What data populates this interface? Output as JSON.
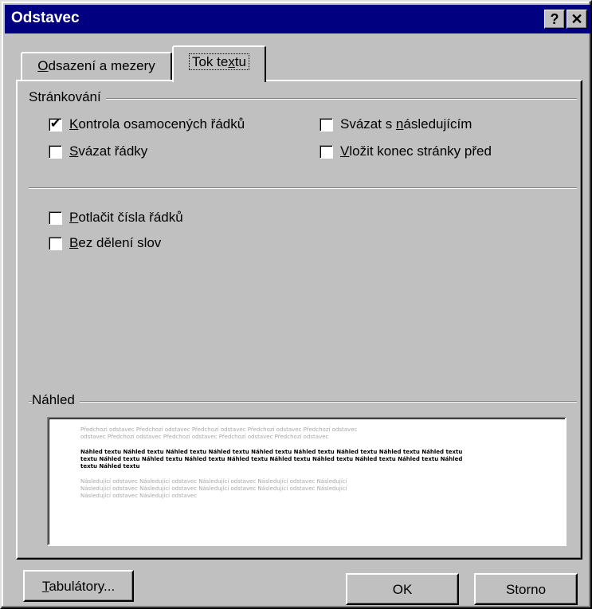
{
  "window": {
    "title": "Odstavec"
  },
  "titlebar": {
    "help_label": "?",
    "close_label": "✕"
  },
  "tabs": [
    {
      "label_u": "O",
      "label_rest": "dsazení a mezery",
      "active": false
    },
    {
      "label_pre": "Tok te",
      "label_u": "x",
      "label_rest": "tu",
      "active": true
    }
  ],
  "pagination": {
    "group_label": "Stránkování",
    "widow_control": {
      "label_u": "K",
      "label_rest": "ontrola osamocených řádků",
      "checked": true
    },
    "keep_with_next": {
      "label_pre": "Svázat s ",
      "label_u": "n",
      "label_rest": "ásledujícím",
      "checked": false
    },
    "keep_lines": {
      "label_u": "S",
      "label_rest": "vázat řádky",
      "checked": false
    },
    "page_break_before": {
      "label_u": "V",
      "label_rest": "ložit konec stránky před",
      "checked": false
    }
  },
  "options": {
    "suppress_line_numbers": {
      "label_u": "P",
      "label_rest": "otlačit čísla řádků",
      "checked": false
    },
    "no_hyphenation": {
      "label_u": "B",
      "label_rest": "ez dělení slov",
      "checked": false
    }
  },
  "preview": {
    "label": "Náhled",
    "prev_lines": [
      "Předchozí odstavec Předchozí odstavec Předchozí odstavec Předchozí odstavec Předchozí odstavec",
      "odstavec Předchozí odstavec Předchozí odstavec Předchozí odstavec Předchozí odstavec"
    ],
    "cur_lines": [
      "Náhled textu Náhled textu Náhled textu Náhled textu Náhled textu Náhled textu Náhled textu Náhled textu Náhled textu",
      "textu Náhled textu Náhled textu Náhled textu Náhled textu Náhled textu Náhled textu Náhled textu Náhled textu Náhled",
      "textu Náhled textu"
    ],
    "next_lines": [
      "Následující odstavec Následující odstavec Následující odstavec Následující odstavec Následující",
      "Následující odstavec Následující odstavec Následující odstavec Následující odstavec Následující",
      "Následující odstavec Následující odstavec"
    ]
  },
  "buttons": {
    "tabs_u": "T",
    "tabs_rest": "abulátory...",
    "ok": "OK",
    "cancel": "Storno"
  }
}
